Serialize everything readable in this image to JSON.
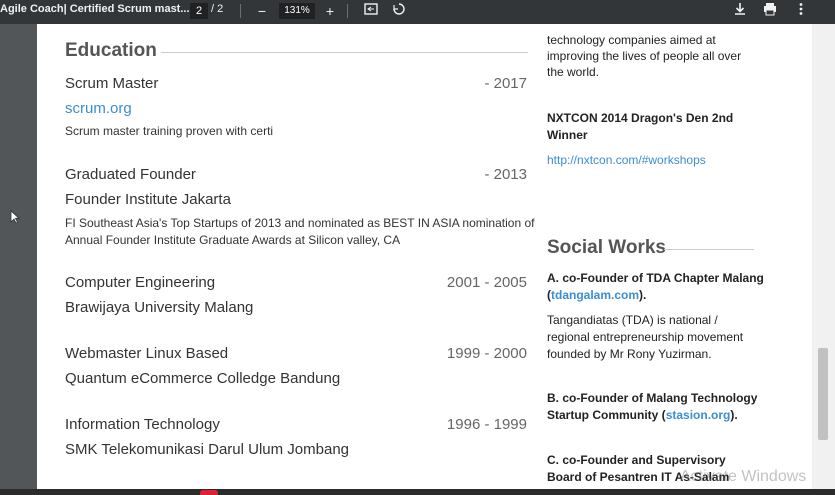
{
  "toolbar": {
    "doc_title": "Agile Coach| Certified Scrum mast...",
    "page_current": "2",
    "page_sep": "/",
    "page_total": "2",
    "zoom_out": "−",
    "zoom": "131%",
    "zoom_in": "+",
    "icons": [
      "fit-page-icon",
      "rotate-icon",
      "download-icon",
      "print-icon",
      "more-vert-icon"
    ]
  },
  "education": {
    "heading": "Education",
    "items": [
      {
        "title": "Scrum Master",
        "year": "- 2017",
        "org": "scrum.org",
        "desc": "Scrum master training proven with certi"
      },
      {
        "title": "Graduated Founder",
        "year": "- 2013",
        "org": "Founder Institute Jakarta",
        "desc": "FI Southeast Asia's Top Startups of 2013 and nominated as BEST IN ASIA nomination of Annual Founder Institute Graduate Awards at Silicon valley, CA"
      },
      {
        "title": "Computer Engineering",
        "year": "2001 - 2005",
        "org": "Brawijaya University Malang"
      },
      {
        "title": "Webmaster Linux Based",
        "year": "1999 - 2000",
        "org": "Quantum eCommerce Colledge Bandung"
      },
      {
        "title": "Information Technology",
        "year": "1996 - 1999",
        "org": "SMK Telekomunikasi Darul Ulum Jombang"
      }
    ]
  },
  "right": {
    "intro_text": "technology companies aimed at improving the lives of people all over the world.",
    "nxtcon_title": "NXTCON 2014 Dragon's Den 2nd Winner",
    "nxtcon_link": "http://nxtcon.com/#workshops",
    "social_heading": "Social Works",
    "a_title": "A. co-Founder of TDA Chapter Malang",
    "a_link": "tdangalam.com",
    "a_desc": "Tangandiatas (TDA) is national / regional entrepreneurship movement founded by Mr Rony Yuzirman.",
    "b_title": "B. co-Founder of Malang Technology Startup Community",
    "b_link": "stasion.org",
    "c_title": "C. co-Founder and Supervisory Board of Pesantren IT As-Salam"
  },
  "watermark": "Activate Windows"
}
